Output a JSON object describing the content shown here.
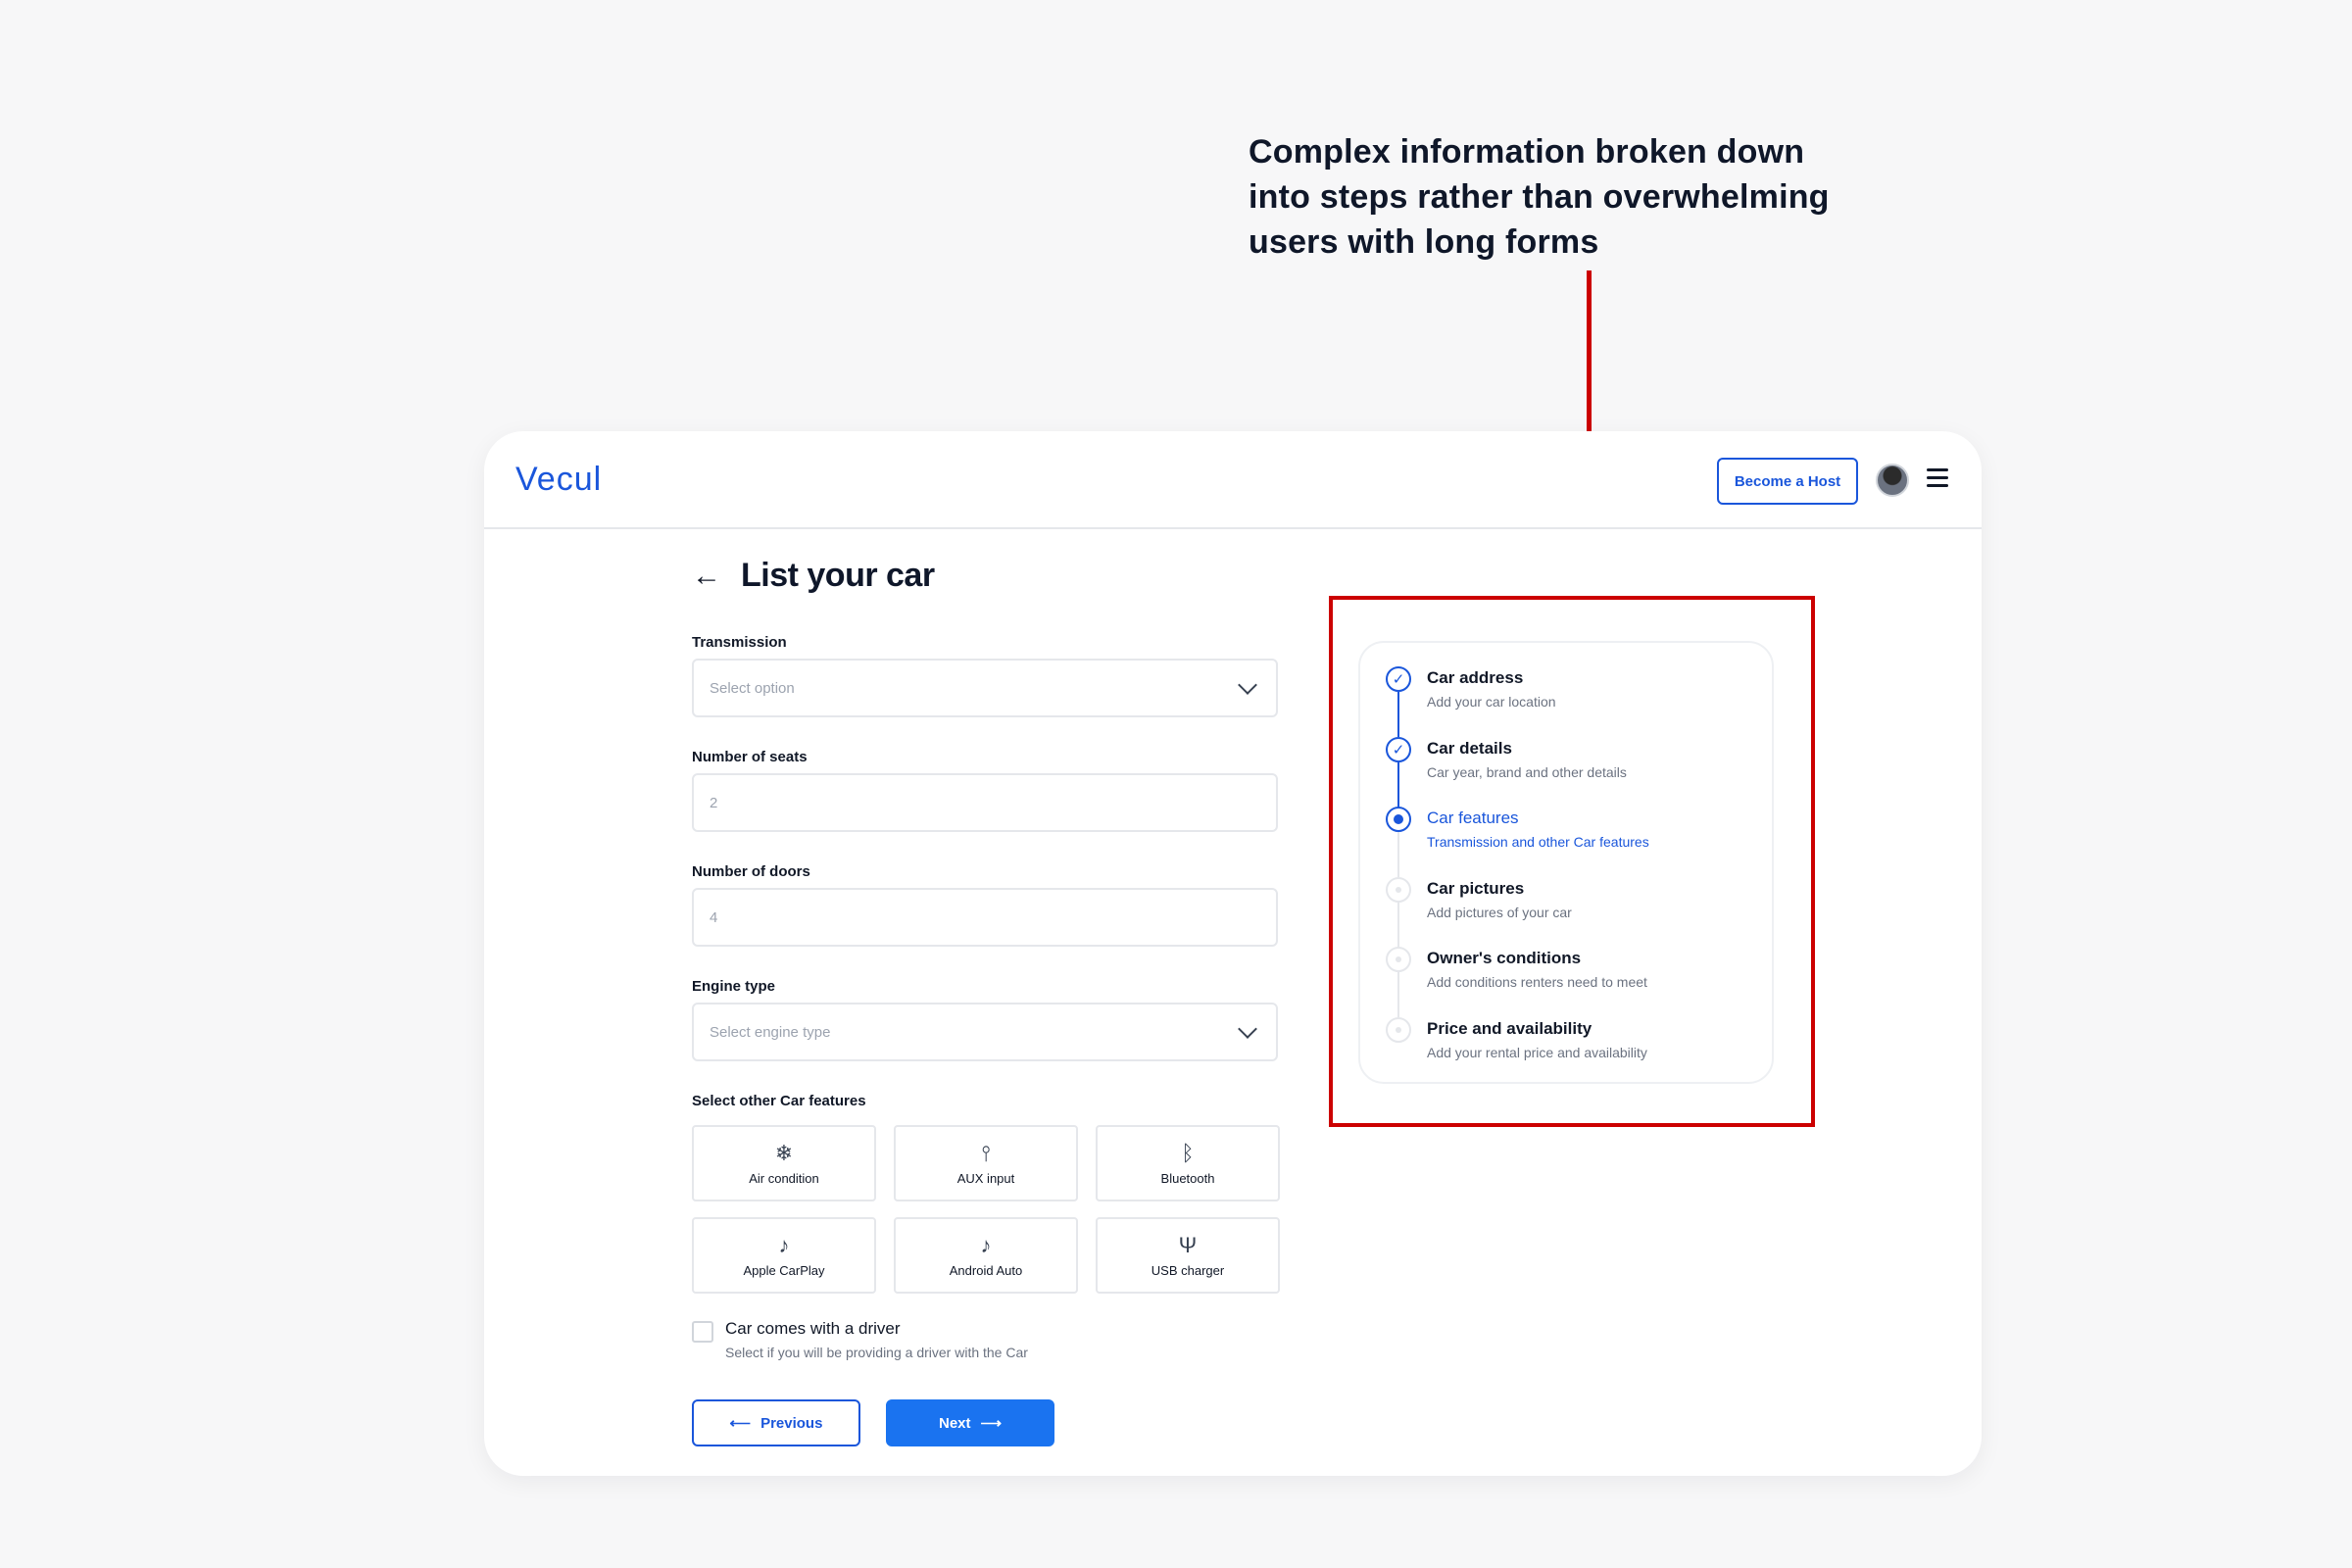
{
  "annotation": {
    "text": "Complex information broken down into steps rather than overwhelming users with long forms"
  },
  "header": {
    "logo": "Vecul",
    "become_host": "Become a Host",
    "avatar_alt": "User avatar"
  },
  "page": {
    "title": "List your car"
  },
  "form": {
    "transmission": {
      "label": "Transmission",
      "placeholder": "Select option"
    },
    "seats": {
      "label": "Number of seats",
      "placeholder": "2"
    },
    "doors": {
      "label": "Number of doors",
      "placeholder": "4"
    },
    "engine": {
      "label": "Engine type",
      "placeholder": "Select engine type"
    },
    "features_label": "Select other Car features",
    "features": [
      {
        "label": "Air condition",
        "icon": "snowflake-icon"
      },
      {
        "label": "AUX input",
        "icon": "aux-icon"
      },
      {
        "label": "Bluetooth",
        "icon": "bluetooth-icon"
      },
      {
        "label": "Apple CarPlay",
        "icon": "music-note-icon"
      },
      {
        "label": "Android Auto",
        "icon": "music-note-icon"
      },
      {
        "label": "USB charger",
        "icon": "usb-icon"
      }
    ],
    "driver": {
      "title": "Car comes with a driver",
      "subtitle": "Select if you will be providing a driver with the Car"
    },
    "previous": "Previous",
    "next": "Next"
  },
  "steps": [
    {
      "title": "Car address",
      "desc": "Add your car location",
      "status": "done"
    },
    {
      "title": "Car details",
      "desc": "Car year, brand and other details",
      "status": "done"
    },
    {
      "title": "Car features",
      "desc": "Transmission and other Car features",
      "status": "current"
    },
    {
      "title": "Car pictures",
      "desc": "Add pictures of your car",
      "status": "pending"
    },
    {
      "title": "Owner's conditions",
      "desc": "Add conditions renters need to meet",
      "status": "pending"
    },
    {
      "title": "Price and availability",
      "desc": "Add your rental price and availability",
      "status": "pending"
    }
  ],
  "colors": {
    "accent": "#1a56db",
    "annotation_red": "#cc0000"
  }
}
